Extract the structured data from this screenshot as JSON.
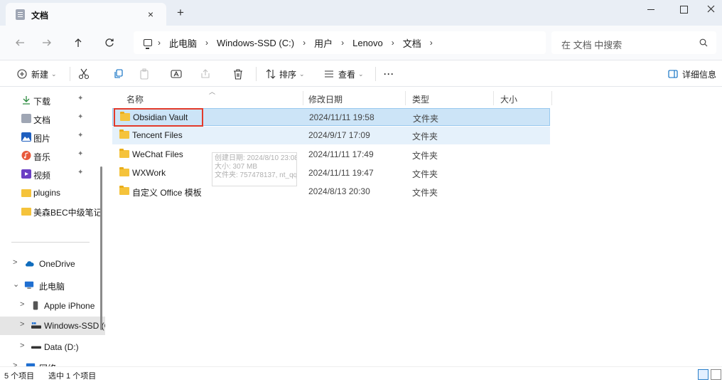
{
  "tab": {
    "title": "文档",
    "close": "×",
    "new_tab": "+"
  },
  "window_controls": [
    "minimize",
    "maximize",
    "close"
  ],
  "breadcrumb": {
    "items": [
      "此电脑",
      "Windows-SSD (C:)",
      "用户",
      "Lenovo",
      "文档"
    ],
    "separator": "›"
  },
  "search": {
    "placeholder": "在 文档 中搜索"
  },
  "toolbar": {
    "new_label": "新建",
    "sort_label": "排序",
    "view_label": "查看",
    "more_label": "···",
    "details_label": "详细信息",
    "caret": "⌄"
  },
  "sidebar": {
    "quick_access": [
      {
        "label": "下载",
        "icon": "download-icon",
        "pinned": true
      },
      {
        "label": "文档",
        "icon": "documents-icon",
        "pinned": true
      },
      {
        "label": "图片",
        "icon": "pictures-icon",
        "pinned": true
      },
      {
        "label": "音乐",
        "icon": "music-icon",
        "pinned": true
      },
      {
        "label": "视频",
        "icon": "videos-icon",
        "pinned": true
      },
      {
        "label": "plugins",
        "icon": "folder-icon",
        "pinned": false
      },
      {
        "label": "美森BEC中级笔记",
        "icon": "folder-icon",
        "pinned": false
      }
    ],
    "tree": [
      {
        "label": "OneDrive",
        "icon": "cloud-icon",
        "expander": ">"
      },
      {
        "label": "此电脑",
        "icon": "pc-icon",
        "expander": "⌄"
      },
      {
        "label": "Apple iPhone",
        "icon": "phone-icon",
        "expander": ">"
      },
      {
        "label": "Windows-SSD (C:)",
        "icon": "drive-icon",
        "expander": ">",
        "selected": true
      },
      {
        "label": "Data (D:)",
        "icon": "drive-icon",
        "expander": ">"
      },
      {
        "label": "网络",
        "icon": "network-icon",
        "expander": ">"
      }
    ],
    "pin_glyph": "📌"
  },
  "columns": {
    "name": "名称",
    "modified": "修改日期",
    "type": "类型",
    "size": "大小"
  },
  "files": [
    {
      "name": "Obsidian Vault",
      "modified": "2024/11/11 19:58",
      "type": "文件夹",
      "selected": true
    },
    {
      "name": "Tencent Files",
      "modified": "2024/9/17 17:09",
      "type": "文件夹",
      "hover": true
    },
    {
      "name": "WeChat Files",
      "modified": "2024/11/11 17:49",
      "type": "文件夹"
    },
    {
      "name": "WXWork",
      "modified": "2024/11/11 19:47",
      "type": "文件夹"
    },
    {
      "name": "自定义 Office 模板",
      "modified": "2024/8/13 20:30",
      "type": "文件夹"
    }
  ],
  "tooltip": {
    "line1": "创建日期: 2024/8/10 23:08",
    "line2": "大小: 307 MB",
    "line3": "文件夹: 757478137, nt_qq"
  },
  "status": {
    "item_count": "5 个项目",
    "selection": "选中 1 个项目"
  },
  "colors": {
    "selection": "#cce4f7",
    "selection_border": "#99c9ef",
    "folder": "#f5c33b",
    "annotation": "#e23a2b",
    "accent": "#0067c0"
  }
}
